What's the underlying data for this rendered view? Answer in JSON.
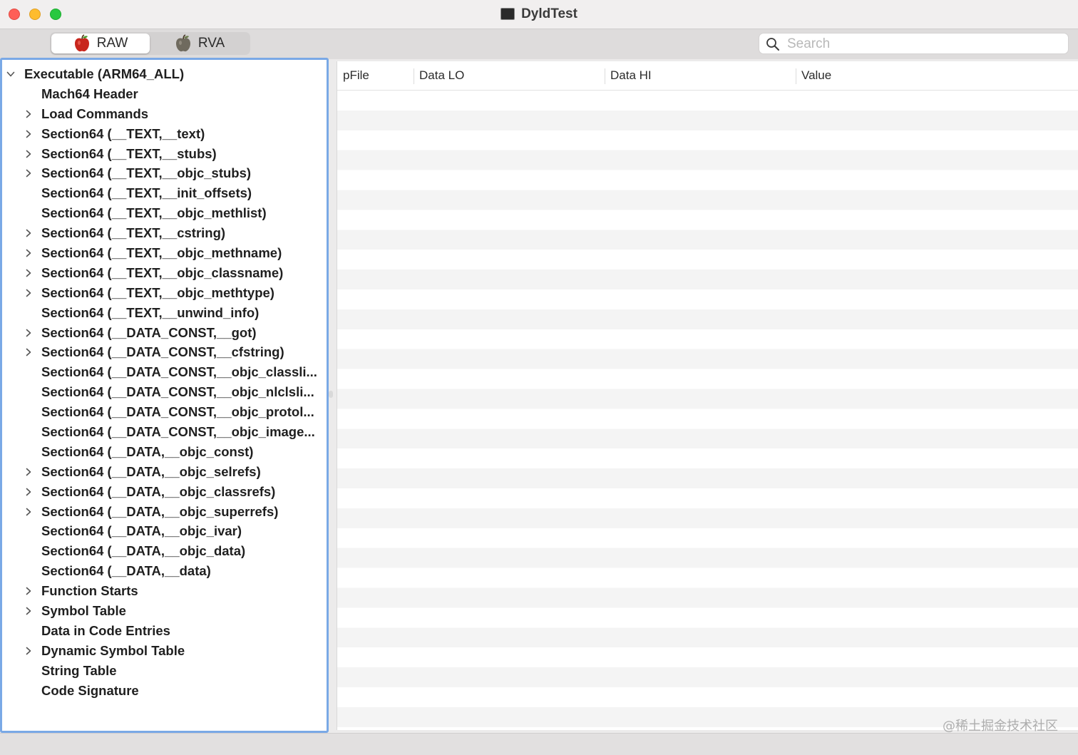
{
  "window": {
    "title": "DyldTest"
  },
  "toolbar": {
    "modes": [
      {
        "label": "RAW",
        "selected": true
      },
      {
        "label": "RVA",
        "selected": false
      }
    ],
    "search": {
      "placeholder": "Search",
      "value": ""
    }
  },
  "tree": {
    "items": [
      {
        "label": "Executable  (ARM64_ALL)",
        "level": 0,
        "expandable": true,
        "expanded": true
      },
      {
        "label": "Mach64 Header",
        "level": 1,
        "expandable": false
      },
      {
        "label": "Load Commands",
        "level": 1,
        "expandable": true
      },
      {
        "label": "Section64 (__TEXT,__text)",
        "level": 1,
        "expandable": true
      },
      {
        "label": "Section64 (__TEXT,__stubs)",
        "level": 1,
        "expandable": true
      },
      {
        "label": "Section64 (__TEXT,__objc_stubs)",
        "level": 1,
        "expandable": true
      },
      {
        "label": "Section64 (__TEXT,__init_offsets)",
        "level": 1,
        "expandable": false
      },
      {
        "label": "Section64 (__TEXT,__objc_methlist)",
        "level": 1,
        "expandable": false
      },
      {
        "label": "Section64 (__TEXT,__cstring)",
        "level": 1,
        "expandable": true
      },
      {
        "label": "Section64 (__TEXT,__objc_methname)",
        "level": 1,
        "expandable": true
      },
      {
        "label": "Section64 (__TEXT,__objc_classname)",
        "level": 1,
        "expandable": true
      },
      {
        "label": "Section64 (__TEXT,__objc_methtype)",
        "level": 1,
        "expandable": true
      },
      {
        "label": "Section64 (__TEXT,__unwind_info)",
        "level": 1,
        "expandable": false
      },
      {
        "label": "Section64 (__DATA_CONST,__got)",
        "level": 1,
        "expandable": true
      },
      {
        "label": "Section64 (__DATA_CONST,__cfstring)",
        "level": 1,
        "expandable": true
      },
      {
        "label": "Section64 (__DATA_CONST,__objc_classli...",
        "level": 1,
        "expandable": false
      },
      {
        "label": "Section64 (__DATA_CONST,__objc_nlclsli...",
        "level": 1,
        "expandable": false
      },
      {
        "label": "Section64 (__DATA_CONST,__objc_protol...",
        "level": 1,
        "expandable": false
      },
      {
        "label": "Section64 (__DATA_CONST,__objc_image...",
        "level": 1,
        "expandable": false
      },
      {
        "label": "Section64 (__DATA,__objc_const)",
        "level": 1,
        "expandable": false
      },
      {
        "label": "Section64 (__DATA,__objc_selrefs)",
        "level": 1,
        "expandable": true
      },
      {
        "label": "Section64 (__DATA,__objc_classrefs)",
        "level": 1,
        "expandable": true
      },
      {
        "label": "Section64 (__DATA,__objc_superrefs)",
        "level": 1,
        "expandable": true
      },
      {
        "label": "Section64 (__DATA,__objc_ivar)",
        "level": 1,
        "expandable": false
      },
      {
        "label": "Section64 (__DATA,__objc_data)",
        "level": 1,
        "expandable": false
      },
      {
        "label": "Section64 (__DATA,__data)",
        "level": 1,
        "expandable": false
      },
      {
        "label": "Function Starts",
        "level": 1,
        "expandable": true
      },
      {
        "label": "Symbol Table",
        "level": 1,
        "expandable": true
      },
      {
        "label": "Data in Code Entries",
        "level": 1,
        "expandable": false
      },
      {
        "label": "Dynamic Symbol Table",
        "level": 1,
        "expandable": true
      },
      {
        "label": "String Table",
        "level": 1,
        "expandable": false
      },
      {
        "label": "Code Signature",
        "level": 1,
        "expandable": false
      }
    ]
  },
  "table": {
    "columns": [
      {
        "label": "pFile"
      },
      {
        "label": "Data LO"
      },
      {
        "label": "Data HI"
      },
      {
        "label": "Value"
      }
    ],
    "rows": []
  },
  "watermark": "@稀土掘金技术社区"
}
